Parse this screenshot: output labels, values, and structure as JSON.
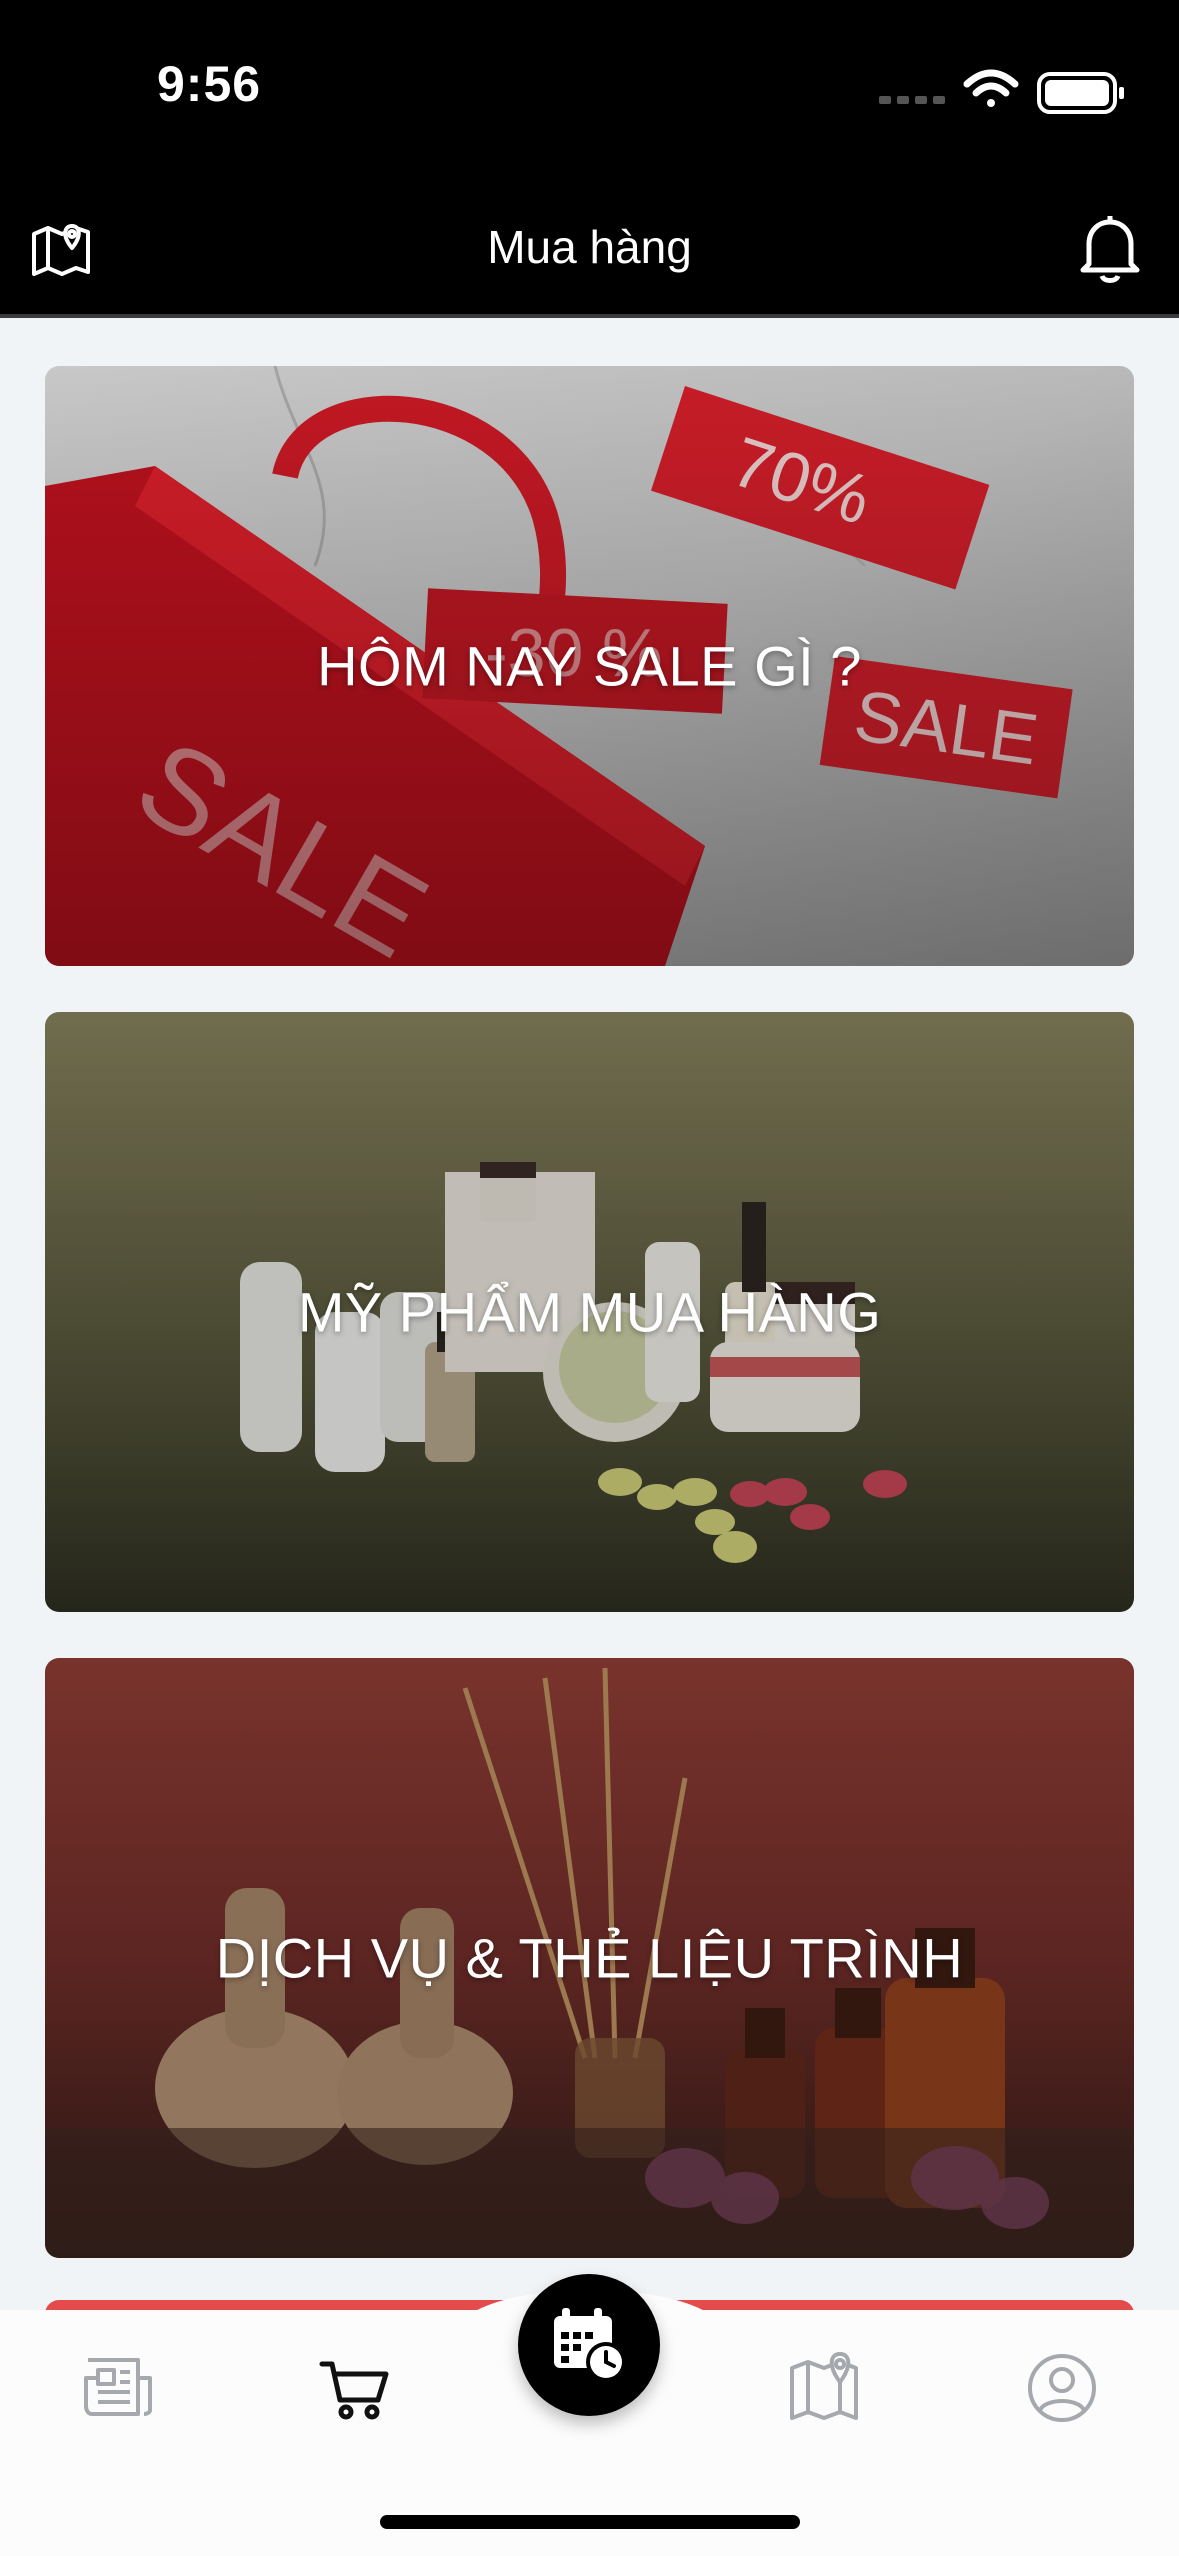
{
  "status_bar": {
    "time": "9:56"
  },
  "header": {
    "title": "Mua hàng"
  },
  "cards": [
    {
      "label": "HÔM NAY SALE GÌ ?"
    },
    {
      "label": "MỸ PHẨM MUA HÀNG"
    },
    {
      "label": "DỊCH VỤ & THẺ LIỆU TRÌNH"
    }
  ],
  "tabs": [
    {
      "icon": "newspaper-icon"
    },
    {
      "icon": "cart-icon",
      "active": true
    },
    {
      "icon": "calendar-clock-icon"
    },
    {
      "icon": "map-pin-icon"
    },
    {
      "icon": "user-circle-icon"
    }
  ],
  "colors": {
    "bar": "#000000",
    "accent": "#e44c4c",
    "background": "#f1f4f6"
  }
}
